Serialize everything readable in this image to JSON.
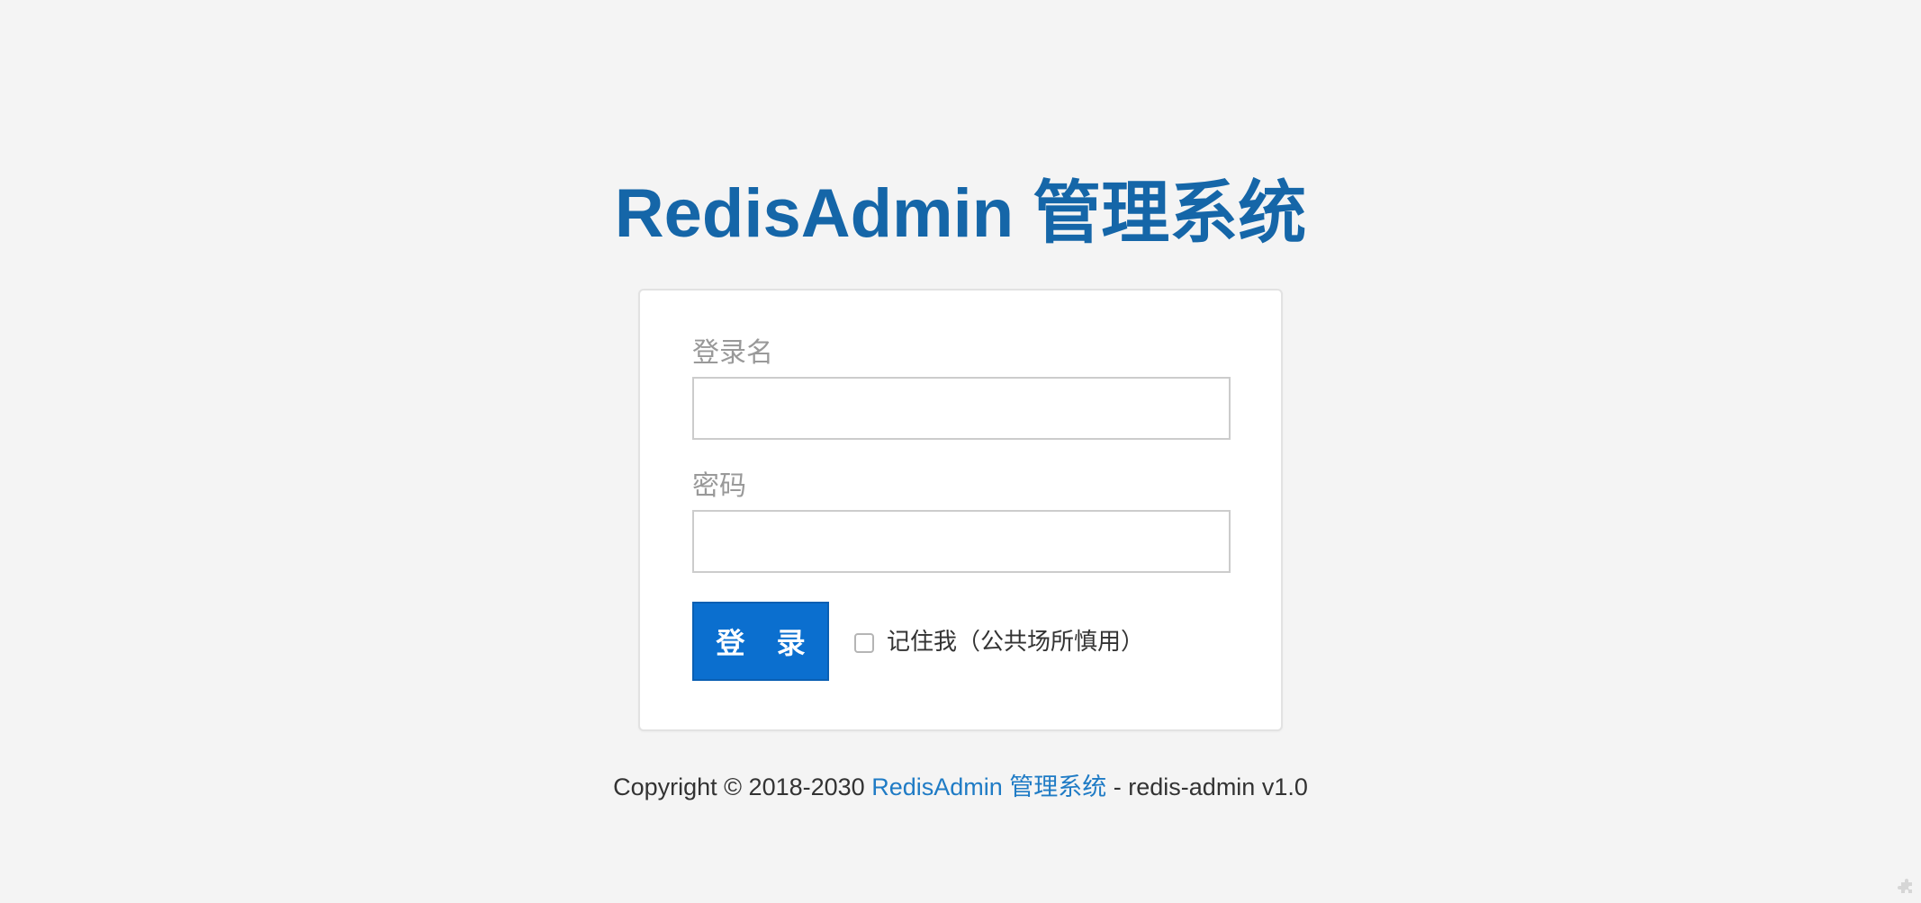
{
  "header": {
    "title": "RedisAdmin 管理系统"
  },
  "login_form": {
    "username_label": "登录名",
    "username_value": "",
    "username_placeholder": "",
    "password_label": "密码",
    "password_value": "",
    "password_placeholder": "",
    "login_button_label": "登 录",
    "remember_me_label": "记住我（公共场所慎用）",
    "remember_me_checked": false
  },
  "footer": {
    "copyright_prefix": "Copyright © 2018-2030",
    "link_text": "RedisAdmin 管理系统",
    "suffix": "- redis-admin v1.0"
  },
  "icons": {
    "corner": "puzzle-icon"
  },
  "colors": {
    "background": "#f4f4f4",
    "title": "#1566a8",
    "button": "#0b6fcf",
    "link": "#1f7bc5",
    "label": "#999999"
  }
}
